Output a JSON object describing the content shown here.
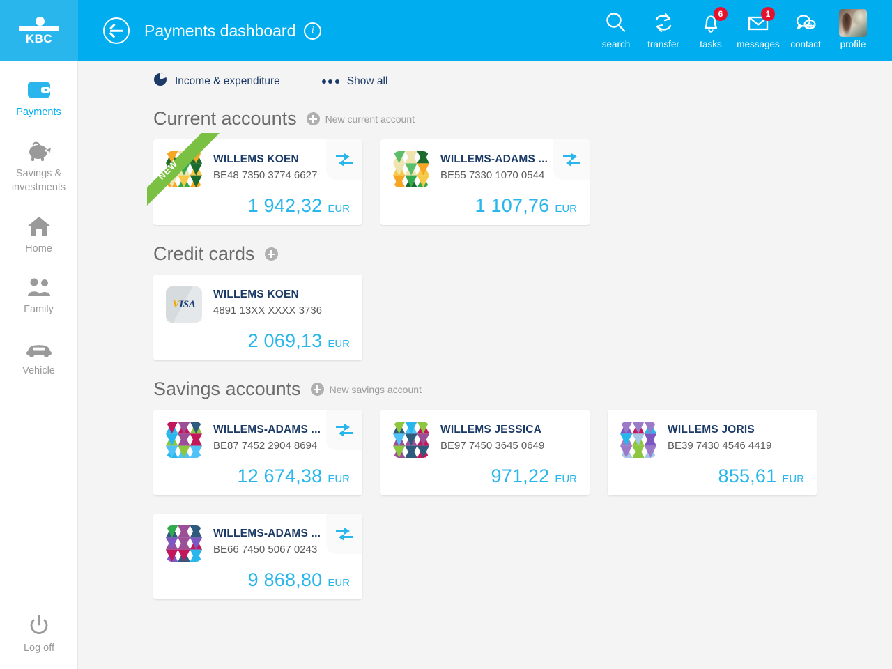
{
  "brand": {
    "logo_text": "KBC",
    "accent": "#00AEEF",
    "amount_color": "#29B6EC",
    "badge_color": "#E8112D"
  },
  "header": {
    "title": "Payments dashboard",
    "back_icon": "back-arrow-circle-icon",
    "info_icon": "info-icon",
    "actions": [
      {
        "label": "search",
        "icon": "search-icon",
        "badge": ""
      },
      {
        "label": "transfer",
        "icon": "transfer-icon",
        "badge": ""
      },
      {
        "label": "tasks",
        "icon": "bell-icon",
        "badge": "6"
      },
      {
        "label": "messages",
        "icon": "envelope-icon",
        "badge": "1"
      },
      {
        "label": "contact",
        "icon": "chat-bubble-icon",
        "badge": ""
      },
      {
        "label": "profile",
        "icon": "avatar-photo",
        "badge": ""
      }
    ]
  },
  "sidebar": {
    "items": [
      {
        "label": "Payments",
        "icon": "wallet-icon",
        "active": true
      },
      {
        "label": "Savings & investments",
        "icon": "piggy-bank-icon",
        "active": false
      },
      {
        "label": "Home",
        "icon": "house-icon",
        "active": false
      },
      {
        "label": "Family",
        "icon": "family-icon",
        "active": false
      },
      {
        "label": "Vehicle",
        "icon": "car-icon",
        "active": false
      }
    ],
    "logoff": {
      "label": "Log off",
      "icon": "power-icon"
    }
  },
  "toolbar": {
    "income_expenditure": "Income & expenditure",
    "income_icon": "pie-chart-icon",
    "show_all": "Show all",
    "show_all_icon": "ellipsis-icon"
  },
  "sections": [
    {
      "title": "Current accounts",
      "add_icon": "plus-circle-icon",
      "add_label": "New current account",
      "cards": [
        {
          "name": "WILLEMS KOEN",
          "iban": "BE48 7350 3774 6627",
          "amount": "1 942,32",
          "currency": "EUR",
          "transfer": true,
          "ribbon": "NEW",
          "avatar_type": "mosaic-green-orange",
          "avatar_colors": [
            "#F5A623",
            "#33A94E",
            "#EFE4B0",
            "#1C6B2E",
            "#F7C948",
            "#5BBF6A"
          ]
        },
        {
          "name": "WILLEMS-ADAMS ...",
          "iban": "BE55 7330 1070 0544",
          "amount": "1 107,76",
          "currency": "EUR",
          "transfer": true,
          "ribbon": "",
          "avatar_type": "mosaic-green-orange",
          "avatar_colors": [
            "#33A94E",
            "#F5A623",
            "#EFE4B0",
            "#1C6B2E",
            "#F7C948",
            "#5BBF6A"
          ]
        }
      ]
    },
    {
      "title": "Credit cards",
      "add_icon": "plus-circle-icon",
      "add_label": "",
      "cards": [
        {
          "name": "WILLEMS KOEN",
          "iban": "4891 13XX XXXX 3736",
          "amount": "2 069,13",
          "currency": "EUR",
          "transfer": false,
          "ribbon": "",
          "avatar_type": "visa-card",
          "visa_text": "VISA"
        }
      ]
    },
    {
      "title": "Savings accounts",
      "add_icon": "plus-circle-icon",
      "add_label": "New savings account",
      "cards": [
        {
          "name": "WILLEMS-ADAMS ...",
          "iban": "BE87 7452 2904 8694",
          "amount": "12 674,38",
          "currency": "EUR",
          "transfer": true,
          "ribbon": "",
          "avatar_type": "mosaic-blue-purple",
          "avatar_colors": [
            "#2E5A7D",
            "#29B6EC",
            "#9B4F96",
            "#8DC63F",
            "#C2185B",
            "#4FC3F7"
          ]
        },
        {
          "name": "WILLEMS JESSICA",
          "iban": "BE97 7450 3645 0649",
          "amount": "971,22",
          "currency": "EUR",
          "transfer": false,
          "ribbon": "",
          "avatar_type": "mosaic-blue-purple",
          "avatar_colors": [
            "#2E5A7D",
            "#29B6EC",
            "#9B4F96",
            "#8DC63F",
            "#C2185B",
            "#4FC3F7"
          ]
        },
        {
          "name": "WILLEMS JORIS",
          "iban": "BE39 7430 4546 4419",
          "amount": "855,61",
          "currency": "EUR",
          "transfer": false,
          "ribbon": "",
          "avatar_type": "mosaic-violet-green",
          "avatar_colors": [
            "#C2185B",
            "#9B7BC8",
            "#8DC63F",
            "#A7C7E7",
            "#29B6EC",
            "#7E57C2"
          ]
        },
        {
          "name": "WILLEMS-ADAMS ...",
          "iban": "BE66 7450 5067 0243",
          "amount": "9 868,80",
          "currency": "EUR",
          "transfer": true,
          "ribbon": "",
          "avatar_type": "mosaic-violet-blue",
          "avatar_colors": [
            "#33A94E",
            "#9B4F96",
            "#29B6EC",
            "#7E57C2",
            "#2E5A7D",
            "#C2185B"
          ]
        }
      ]
    }
  ]
}
